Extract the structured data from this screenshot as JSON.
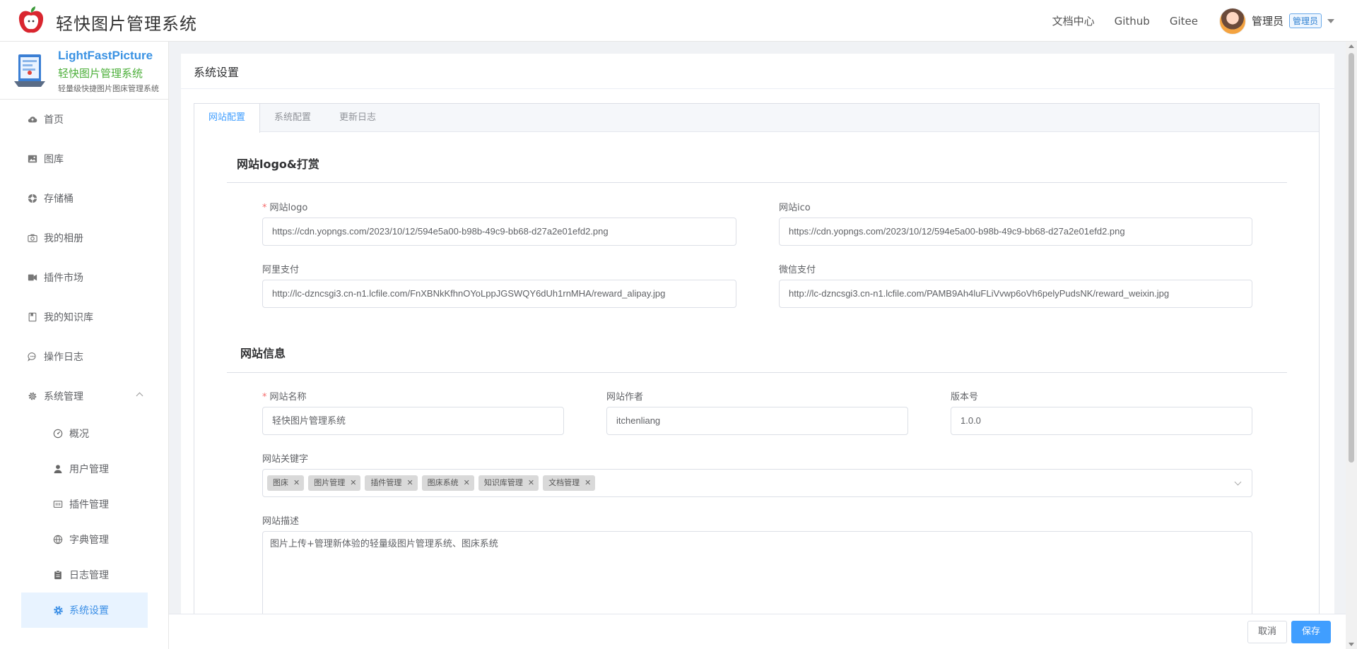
{
  "header": {
    "app_title": "轻快图片管理系统",
    "nav": [
      "文档中心",
      "Github",
      "Gitee"
    ],
    "user_name": "管理员",
    "role_badge": "管理员"
  },
  "sidebar": {
    "brand_en": "LightFastPicture",
    "brand_cn": "轻快图片管理系统",
    "brand_sub": "轻量级快捷图片图床管理系统",
    "items": [
      {
        "label": "首页",
        "icon": "cloud-icon"
      },
      {
        "label": "图库",
        "icon": "image-icon"
      },
      {
        "label": "存储桶",
        "icon": "bucket-icon"
      },
      {
        "label": "我的相册",
        "icon": "camera-icon"
      },
      {
        "label": "插件市场",
        "icon": "plugin-icon"
      },
      {
        "label": "我的知识库",
        "icon": "book-icon"
      },
      {
        "label": "操作日志",
        "icon": "chat-icon"
      },
      {
        "label": "系统管理",
        "icon": "gear-icon"
      }
    ],
    "sub_items": [
      {
        "label": "概况",
        "icon": "dashboard-icon"
      },
      {
        "label": "用户管理",
        "icon": "user-icon"
      },
      {
        "label": "插件管理",
        "icon": "plugin-manage-icon"
      },
      {
        "label": "字典管理",
        "icon": "dictionary-icon"
      },
      {
        "label": "日志管理",
        "icon": "clipboard-icon"
      },
      {
        "label": "系统设置",
        "icon": "settings-icon"
      }
    ]
  },
  "page": {
    "title": "系统设置",
    "tabs": [
      "网站配置",
      "系统配置",
      "更新日志"
    ],
    "section_logo": "网站logo&打赏",
    "section_info": "网站信息",
    "fields": {
      "logo_label": "网站logo",
      "logo_value": "https://cdn.yopngs.com/2023/10/12/594e5a00-b98b-49c9-bb68-d27a2e01efd2.png",
      "ico_label": "网站ico",
      "ico_value": "https://cdn.yopngs.com/2023/10/12/594e5a00-b98b-49c9-bb68-d27a2e01efd2.png",
      "alipay_label": "阿里支付",
      "alipay_value": "http://lc-dzncsgi3.cn-n1.lcfile.com/FnXBNkKfhnOYoLppJGSWQY6dUh1rnMHA/reward_alipay.jpg",
      "wechat_label": "微信支付",
      "wechat_value": "http://lc-dzncsgi3.cn-n1.lcfile.com/PAMB9Ah4luFLiVvwp6oVh6pelyPudsNK/reward_weixin.jpg",
      "name_label": "网站名称",
      "name_value": "轻快图片管理系统",
      "author_label": "网站作者",
      "author_value": "itchenliang",
      "version_label": "版本号",
      "version_value": "1.0.0",
      "keywords_label": "网站关键字",
      "keywords": [
        "图床",
        "图片管理",
        "插件管理",
        "图床系统",
        "知识库管理",
        "文档管理"
      ],
      "desc_label": "网站描述",
      "desc_value": "图片上传+管理新体验的轻量级图片管理系统、图床系统"
    },
    "required_mark": "*"
  },
  "footer": {
    "cancel": "取消",
    "save": "保存"
  },
  "colors": {
    "primary": "#409eff",
    "active_bg": "#e8f3ff",
    "brand_green": "#4caf3a",
    "brand_blue": "#3a92e3"
  }
}
